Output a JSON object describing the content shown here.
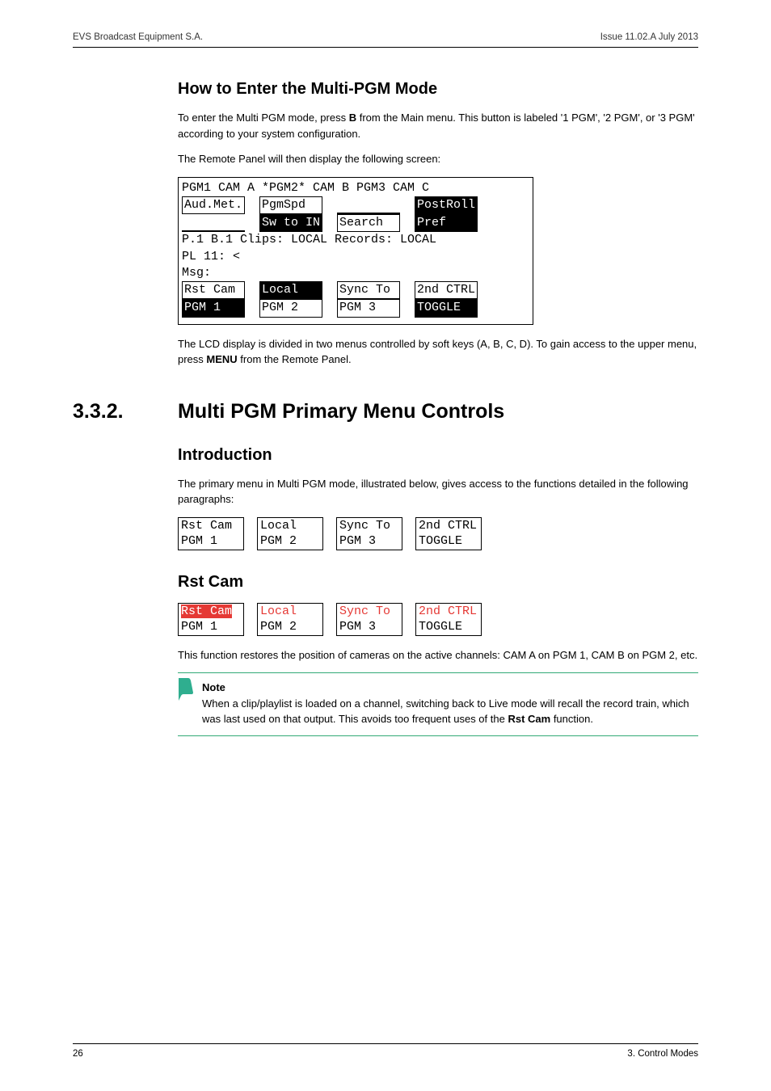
{
  "header": {
    "left": "EVS Broadcast Equipment S.A.",
    "right": "Issue 11.02.A  July 2013"
  },
  "h_enter": "How to Enter the Multi-PGM Mode",
  "p_enter_1a": "To enter the Multi PGM mode, press ",
  "p_enter_1b": "B",
  "p_enter_1c": " from the Main menu. This button is labeled '1 PGM', '2 PGM', or '3 PGM' according to your system configuration.",
  "p_enter_2": "The Remote Panel will then display the following screen:",
  "lcd": {
    "row1": "PGM1 CAM A  *PGM2* CAM B  PGM3 CAM C",
    "r2_a": "Aud.Met.",
    "r2_b": "PgmSpd",
    "r2_c": "",
    "r2_d": "PostRoll",
    "r3_a": "",
    "r3_b": "Sw to IN",
    "r3_c": "Search",
    "r3_d": "Pref",
    "row4": "P.1 B.1 Clips: LOCAL Records: LOCAL",
    "row5": "PL 11: <",
    "row6": "Msg:",
    "r7_a": "Rst Cam",
    "r7_b": "Local",
    "r7_c": "Sync To",
    "r7_d": "2nd CTRL",
    "r8_a": "PGM 1",
    "r8_b": "PGM 2",
    "r8_c": "PGM 3",
    "r8_d": "TOGGLE"
  },
  "p_lcd_after_a": "The LCD display is divided in two menus controlled by soft keys (A, B, C, D). To gain access to the upper menu, press ",
  "p_lcd_after_b": "MENU",
  "p_lcd_after_c": " from the Remote Panel.",
  "sec_num": "3.3.2.",
  "sec_title": "Multi PGM Primary Menu Controls",
  "h_intro": "Introduction",
  "p_intro": "The primary menu in Multi PGM mode, illustrated below, gives access to the functions detailed in the following paragraphs:",
  "sk": {
    "a1": "Rst Cam",
    "b1": "Local",
    "c1": "Sync To",
    "d1": "2nd CTRL",
    "a2": "PGM 1",
    "b2": "PGM 2",
    "c2": "PGM 3",
    "d2": "TOGGLE"
  },
  "h_rst": "Rst Cam",
  "p_rst": "This function restores the position of cameras on the active channels: CAM A on PGM 1, CAM B on PGM 2, etc.",
  "note_title": "Note",
  "note_body_a": "When a clip/playlist is loaded on a channel, switching back to Live mode will recall the record train, which was last used on that output. This avoids too frequent uses of the ",
  "note_body_b": "Rst Cam",
  "note_body_c": " function.",
  "footer": {
    "left": "26",
    "right": "3. Control Modes"
  }
}
